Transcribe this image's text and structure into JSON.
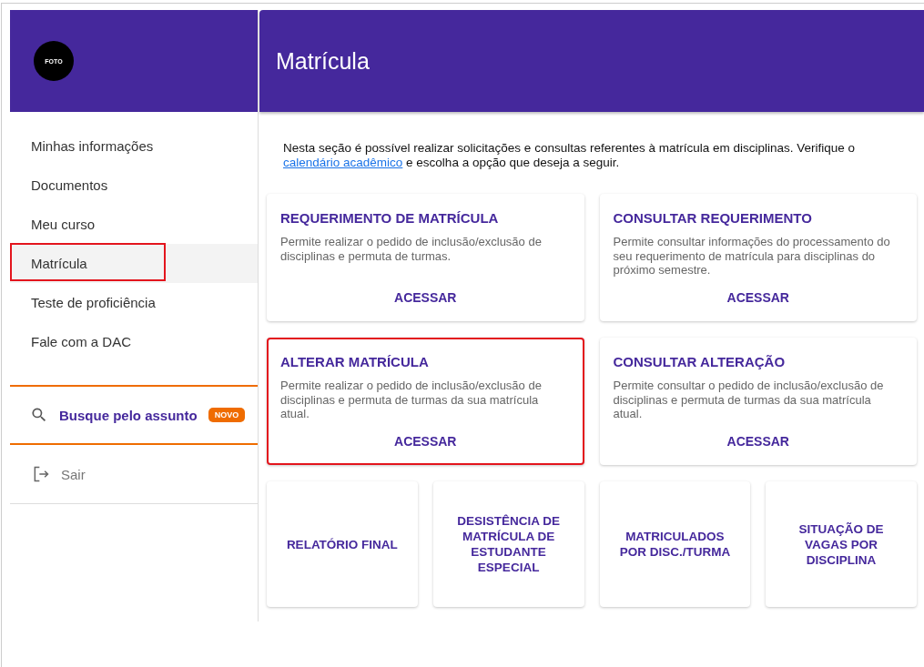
{
  "sidebar": {
    "avatar_label": "FOTO",
    "items": [
      {
        "label": "Minhas informações",
        "selected": false,
        "highlighted": false
      },
      {
        "label": "Documentos",
        "selected": false,
        "highlighted": false
      },
      {
        "label": "Meu curso",
        "selected": false,
        "highlighted": false
      },
      {
        "label": "Matrícula",
        "selected": true,
        "highlighted": true
      },
      {
        "label": "Teste de proficiência",
        "selected": false,
        "highlighted": false
      },
      {
        "label": "Fale com a DAC",
        "selected": false,
        "highlighted": false
      }
    ],
    "search": {
      "label": "Busque pelo assunto",
      "badge": "NOVO"
    },
    "logout": "Sair"
  },
  "page": {
    "title": "Matrícula",
    "intro": {
      "before": "Nesta seção é possível realizar solicitações e consultas referentes à matrícula em disciplinas. Verifique o ",
      "link": "calendário acadêmico",
      "after": " e escolha a opção que deseja a seguir."
    },
    "cards": [
      {
        "title": "REQUERIMENTO DE MATRÍCULA",
        "description": "Permite realizar o pedido de inclusão/exclusão de disciplinas e permuta de turmas.",
        "action": "ACESSAR",
        "highlighted": false
      },
      {
        "title": "CONSULTAR REQUERIMENTO",
        "description": "Permite consultar informações do processamento do seu requerimento de matrícula para disciplinas do próximo semestre.",
        "action": "ACESSAR",
        "highlighted": false
      },
      {
        "title": "ALTERAR MATRÍCULA",
        "description": "Permite realizar o pedido de inclusão/exclusão de disciplinas e permuta de turmas da sua matrícula atual.",
        "action": "ACESSAR",
        "highlighted": true
      },
      {
        "title": "CONSULTAR ALTERAÇÃO",
        "description": "Permite consultar o pedido de inclusão/exclusão de disciplinas e permuta de turmas da sua matrícula atual.",
        "action": "ACESSAR",
        "highlighted": false
      }
    ],
    "tiles": [
      {
        "label": "RELATÓRIO FINAL"
      },
      {
        "label": "DESISTÊNCIA DE MATRÍCULA DE ESTUDANTE ESPECIAL"
      },
      {
        "label": "MATRICULADOS POR DISC./TURMA"
      },
      {
        "label": "SITUAÇÃO DE VAGAS POR DISCIPLINA"
      }
    ]
  }
}
